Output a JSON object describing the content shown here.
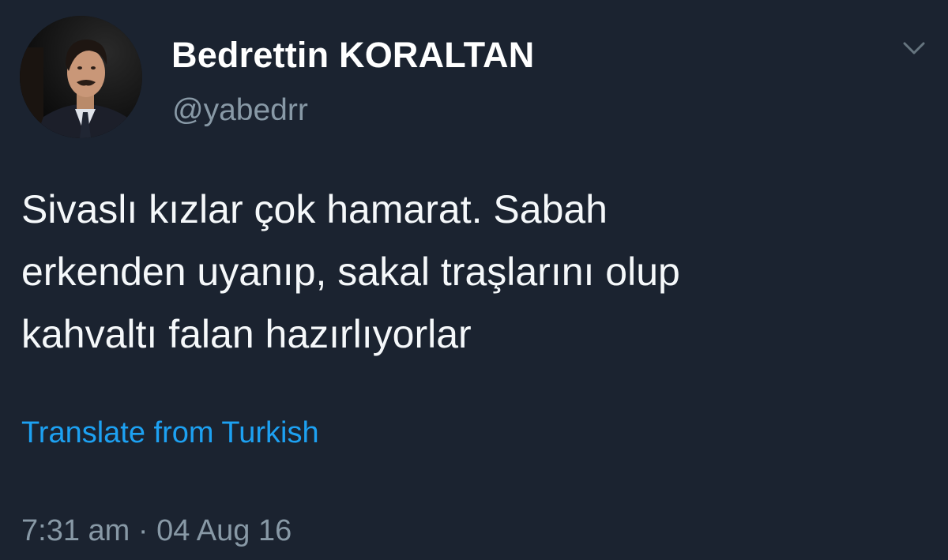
{
  "author": {
    "display_name": "Bedrettin KORALTAN",
    "handle": "@yabedrr"
  },
  "tweet": {
    "lines": [
      "Sivaslı kızlar çok hamarat. Sabah",
      "erkenden uyanıp, sakal traşlarını olup",
      "kahvaltı falan hazırlıyorlar"
    ],
    "translate_label": "Translate from Turkish",
    "timestamp": "7:31 am · 04 Aug 16"
  },
  "icons": {
    "menu": "chevron-down-icon",
    "avatar": "profile-photo"
  },
  "colors": {
    "background": "#1b2330",
    "text": "#f5f8fa",
    "secondary": "#8899a6",
    "link": "#1da1f2"
  }
}
